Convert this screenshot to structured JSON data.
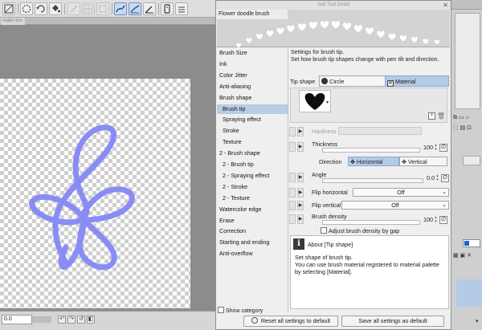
{
  "app": {
    "document_tab": "mako bru",
    "zoom_value": "0.0"
  },
  "dialog": {
    "title": "Sub Tool Detail",
    "close_glyph": "✕",
    "preview_name": "Flower doodle brush",
    "categories": [
      "Brush Size",
      "Ink",
      "Color Jitter",
      "Anti-aliasing",
      "Brush shape",
      "Brush tip",
      "Spraying effect",
      "Stroke",
      "Texture",
      "2 - Brush shape",
      "2 - Brush tip",
      "2 - Spraying effect",
      "2 - Stroke",
      "2 - Texture",
      "Watercolor edge",
      "Erase",
      "Correction",
      "Starting and ending",
      "Anti-overflow"
    ],
    "selected_category": "Brush tip",
    "show_category": "Show category",
    "description_1": "Settings for brush tip.",
    "description_2": "Set how brush tip shapes change with pen tilt and direction.",
    "tip_shape_label": "Tip shape",
    "tip_options": [
      "Circle",
      "Material"
    ],
    "tip_selected": "Material",
    "hardness_label": "Hardness",
    "thickness_label": "Thickness",
    "thickness_value": "100",
    "thickness_level": 1.0,
    "direction_label": "Direction",
    "direction_options": [
      "Horizontal",
      "Vertical"
    ],
    "direction_selected": "Horizontal",
    "angle_label": "Angle",
    "angle_value": "0.0",
    "angle_level": 0.0,
    "flip_horizontal_label": "Flip horizontal",
    "flip_horizontal_value": "Off",
    "flip_vertical_label": "Flip vertical",
    "flip_vertical_value": "Off",
    "brush_density_label": "Brush density",
    "brush_density_value": "100",
    "brush_density_level": 1.0,
    "adjust_density_label": "Adjust brush density by gap",
    "about_title": "About [Tip shape]",
    "about_lines": [
      "Set shape of brush tip.",
      "You can use brush material registered to material palette",
      "by selecting [Material]."
    ],
    "reset_button": "Reset all settings to default",
    "save_button": "Save all settings as default"
  },
  "colors": {
    "stroke": "#8a8cf5",
    "selection": "#b7cde6",
    "dialog_bg": "#efefef"
  }
}
